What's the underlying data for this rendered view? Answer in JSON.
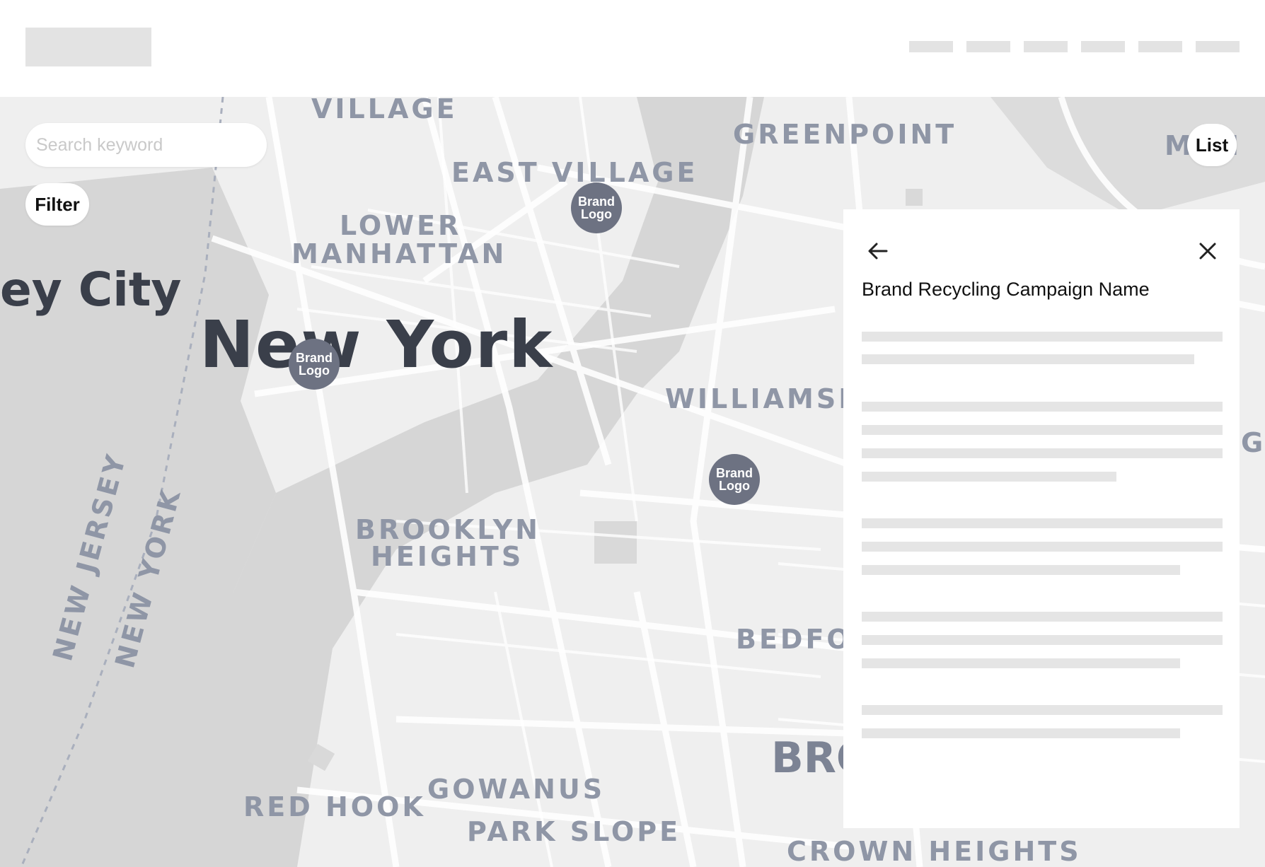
{
  "search": {
    "placeholder": "Search keyword"
  },
  "controls": {
    "filter_label": "Filter",
    "list_label": "List"
  },
  "map": {
    "labels": {
      "village": "VILLAGE",
      "greenpoint": "GREENPOINT",
      "east_village": "EAST VILLAGE",
      "lower": "LOWER",
      "manhattan": "MANHATTAN",
      "jersey_city": "ey City",
      "new_york": "New York",
      "williamsburg": "WILLIAMSB",
      "brooklyn": "BROOKLYN",
      "heights": "HEIGHTS",
      "new_jersey": "NEW JERSEY",
      "new_york_state": "NEW YORK",
      "bedford": "BEDFO",
      "bro": "BRO",
      "gowanus": "GOWANUS",
      "red_hook": "RED HOOK",
      "park_slope": "PARK SLOPE",
      "crown_heights": "CROWN HEIGHTS",
      "m_p": "M   PI",
      "g_edge": "G"
    }
  },
  "pins": [
    {
      "line1": "Brand",
      "line2": "Logo"
    },
    {
      "line1": "Brand",
      "line2": "Logo"
    },
    {
      "line1": "Brand",
      "line2": "Logo"
    }
  ],
  "panel": {
    "title": "Brand Recycling Campaign Name"
  },
  "icons": {
    "back": "arrow-left-icon",
    "close": "close-icon"
  },
  "colors": {
    "pin": "#6d7282",
    "map_bg": "#efefef",
    "placeholder": "#e3e3e3"
  }
}
